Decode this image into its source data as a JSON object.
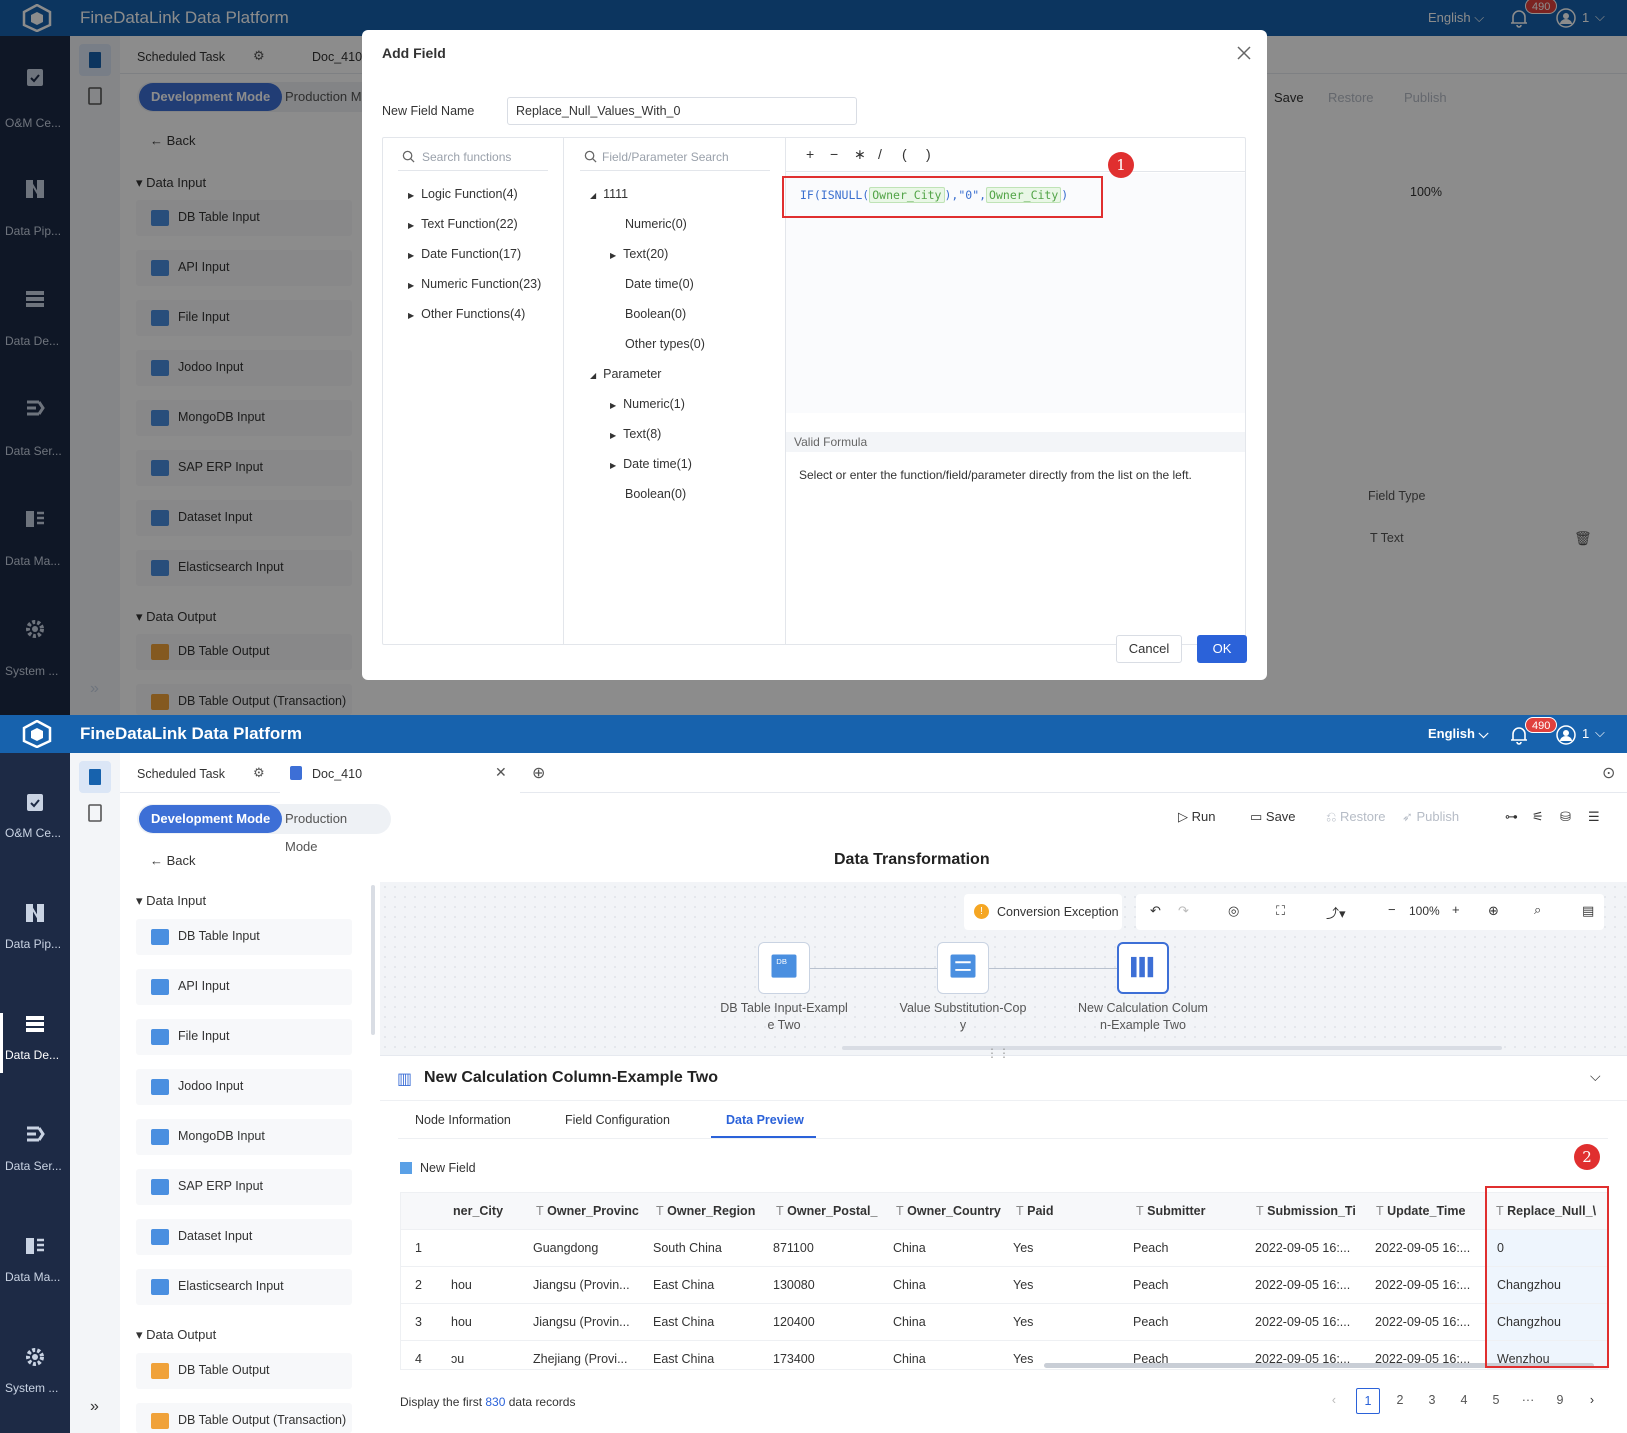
{
  "app": {
    "title": "FineDataLink Data Platform",
    "language": "English",
    "notification_count": "490",
    "user": "1"
  },
  "nav": {
    "items": [
      "O&M Ce...",
      "Data Pip...",
      "Data De...",
      "Data Ser...",
      "Data Ma...",
      "System ..."
    ],
    "expand": "»"
  },
  "tabs": {
    "scheduled": "Scheduled Task",
    "doc": "Doc_410",
    "doc_short": "Doc_410"
  },
  "modes": {
    "dev": "Development Mode",
    "prod": "Production Mode",
    "prod_short": "Production Mo"
  },
  "toolbar": {
    "run": "Run",
    "save": "Save",
    "restore": "Restore",
    "publish": "Publish"
  },
  "back": "Back",
  "page_title": "Data Transformation",
  "sidebar": {
    "input_group": "Data Input",
    "inputs": [
      "DB Table Input",
      "API Input",
      "File Input",
      "Jodoo Input",
      "MongoDB Input",
      "SAP ERP Input",
      "Dataset Input",
      "Elasticsearch Input"
    ],
    "output_group": "Data Output",
    "outputs": [
      "DB Table Output",
      "DB Table Output (Transaction)"
    ]
  },
  "dialog": {
    "title": "Add Field",
    "name_label": "New Field Name",
    "name_value": "Replace_Null_Values_With_0",
    "search_fn_placeholder": "Search functions",
    "functions": [
      "Logic Function(4)",
      "Text Function(22)",
      "Date Function(17)",
      "Numeric Function(23)",
      "Other Functions(4)"
    ],
    "field_search_placeholder": "Field/Parameter Search",
    "tree_root": "1111",
    "fields": [
      "Numeric(0)",
      "Text(20)",
      "Date time(0)",
      "Boolean(0)",
      "Other types(0)"
    ],
    "param_root": "Parameter",
    "params": [
      "Numeric(1)",
      "Text(8)",
      "Date time(1)",
      "Boolean(0)"
    ],
    "operators": [
      "+",
      "−",
      "∗",
      "/",
      "(",
      ")"
    ],
    "formula": {
      "pre": "IF(ISNULL(",
      "tok1": "Owner_City",
      "mid": "),\"0\",",
      "tok2": "Owner_City",
      "post": ")"
    },
    "valid": "Valid Formula",
    "hint": "Select or enter the function/field/parameter directly from the list on the left.",
    "cancel": "Cancel",
    "ok": "OK"
  },
  "bg_panel": {
    "field_type_header": "Field Type",
    "field_type_value": "Text"
  },
  "markers": {
    "one": "1",
    "two": "2"
  },
  "canvas": {
    "exception": "Conversion Exception",
    "zoom": "100%",
    "nodes": [
      {
        "label1": "DB Table Input-Exampl",
        "label2": "e Two",
        "icon": "db-table-input-icon"
      },
      {
        "label1": "Value Substitution-Cop",
        "label2": "y",
        "icon": "value-substitution-icon"
      },
      {
        "label1": "New Calculation Colum",
        "label2": "n-Example Two",
        "icon": "calculation-column-icon"
      }
    ]
  },
  "detail": {
    "title": "New Calculation Column-Example Two",
    "tabs": [
      "Node Information",
      "Field Configuration",
      "Data Preview"
    ],
    "legend": "New Field",
    "columns": [
      "ner_City",
      "Owner_Provinc",
      "Owner_Region",
      "Owner_Postal_",
      "Owner_Country",
      "Paid",
      "Submitter",
      "Submission_Ti",
      "Update_Time",
      "Replace_Null_\\"
    ],
    "rows": [
      [
        "1",
        "",
        "Guangdong",
        "South China",
        "871100",
        "China",
        "Yes",
        "Peach",
        "2022-09-05 16:...",
        "2022-09-05 16:...",
        "0"
      ],
      [
        "2",
        "hou",
        "Jiangsu (Provin...",
        "East China",
        "130080",
        "China",
        "Yes",
        "Peach",
        "2022-09-05 16:...",
        "2022-09-05 16:...",
        "Changzhou"
      ],
      [
        "3",
        "hou",
        "Jiangsu (Provin...",
        "East China",
        "120400",
        "China",
        "Yes",
        "Peach",
        "2022-09-05 16:...",
        "2022-09-05 16:...",
        "Changzhou"
      ],
      [
        "4",
        "ɔu",
        "Zhejiang (Provi...",
        "East China",
        "173400",
        "China",
        "Yes",
        "Peach",
        "2022-09-05 16:...",
        "2022-09-05 16:...",
        "Wenzhou"
      ]
    ],
    "footer_pre": "Display the first",
    "footer_count": "830",
    "footer_post": "data records",
    "pages": [
      "1",
      "2",
      "3",
      "4",
      "5",
      "···",
      "9"
    ]
  }
}
